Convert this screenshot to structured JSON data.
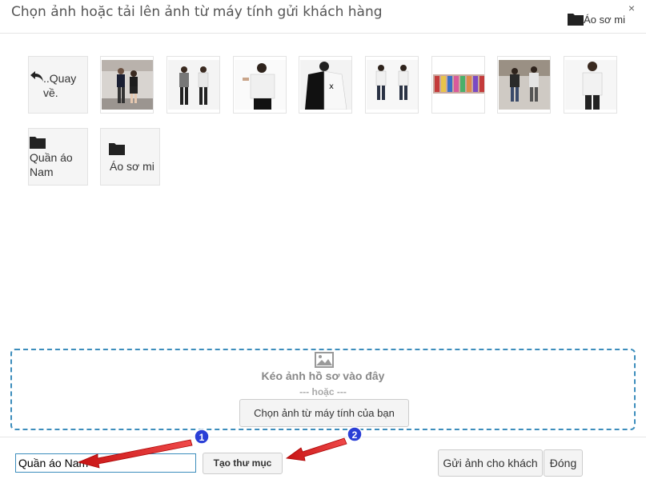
{
  "header": {
    "title": "Chọn ảnh hoặc tải lên ảnh từ máy tính gửi khách hàng",
    "close_label": "×",
    "current_folder": "Áo sơ mi"
  },
  "grid": {
    "back_label": "..Quay về.",
    "folders": [
      {
        "label": "Quần áo Nam"
      },
      {
        "label": "Áo sơ mi"
      }
    ]
  },
  "dropzone": {
    "title": "Kéo ảnh hồ sơ vào đây",
    "or": "--- hoặc ---",
    "choose_button": "Chọn ảnh từ máy tính của bạn"
  },
  "footer": {
    "folder_name_value": "Quần áo Nam",
    "create_button": "Tạo thư mục",
    "send_button": "Gửi ảnh cho khách",
    "close_button": "Đóng"
  },
  "annotations": {
    "marker_1": "1",
    "marker_2": "2",
    "accent": "#e02020",
    "marker_color": "#2a3fd6"
  }
}
